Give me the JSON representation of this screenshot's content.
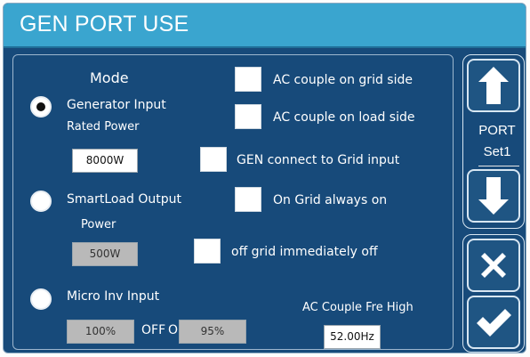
{
  "title": "GEN PORT USE",
  "mode": {
    "heading": "Mode",
    "options": [
      {
        "label": "Generator Input",
        "selected": true
      },
      {
        "label": "SmartLoad Output",
        "selected": false
      },
      {
        "label": "Micro Inv Input",
        "selected": false
      }
    ]
  },
  "generator": {
    "rated_power_label": "Rated Power",
    "rated_power_value": "8000W"
  },
  "smartload": {
    "power_label": "Power",
    "power_value": "500W"
  },
  "micro_inv": {
    "off_value": "100%",
    "on_value": "95%",
    "off_label": "OFF",
    "on_label": "ON"
  },
  "options": {
    "ac_couple_grid": "AC couple on grid side",
    "ac_couple_load": "AC couple on load side",
    "gen_connect_grid": "GEN connect to Grid input",
    "on_grid_always": "On Grid always on",
    "off_grid_immediately": "off grid immediately off"
  },
  "ac_couple_fre_high": {
    "label": "AC Couple Fre High",
    "value": "52.00Hz"
  },
  "side": {
    "port_label": "PORT",
    "port_value": "Set1",
    "icons": [
      "up-arrow-icon",
      "down-arrow-icon",
      "close-icon",
      "check-icon"
    ]
  }
}
